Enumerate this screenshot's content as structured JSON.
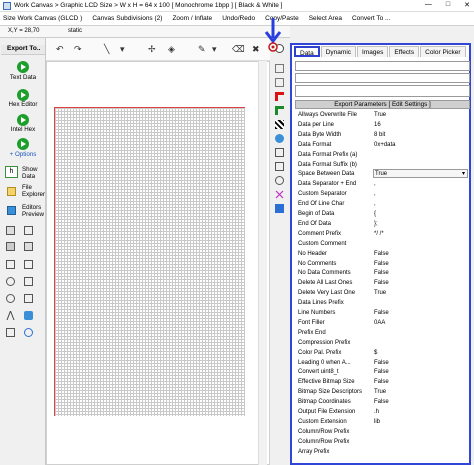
{
  "title": "Work Canvas > Graphic LCD Size > W x H = 64 x 100 [ Monochrome 1bpp ] [ Black & White ]",
  "window_controls": [
    "—",
    "□",
    "✕"
  ],
  "menu": [
    "Size Work Canvas (GLCD )",
    "Canvas Subdivisions (2)",
    "Zoom / Inflate",
    "Undo/Redo",
    "Copy/Paste",
    "Select Area",
    "Convert To ..."
  ],
  "coord": {
    "xy": "X,Y = 28,70",
    "mode": "static"
  },
  "left": {
    "header": "Export To..",
    "export_text": "Text Data",
    "hex_editor": "Hex Editor",
    "intel_hex": "Intel Hex",
    "options": "+ Options",
    "show_data": "Show Data",
    "show_data_btn": "h",
    "file_explorer": "File Explorer",
    "editors_preview": "Editors Preview"
  },
  "tabs": [
    "Data",
    "Dynamic",
    "Images",
    "Effects",
    "Color Picker"
  ],
  "props_header": "Export Parameters [ Edit Settings ]",
  "props": [
    {
      "k": "Allways Overwrite File",
      "v": "True"
    },
    {
      "k": "Data per Line",
      "v": "16"
    },
    {
      "k": "Data Byte Width",
      "v": "8 bit"
    },
    {
      "k": "Data Format",
      "v": "0x+data"
    },
    {
      "k": "Data Format Prefix (a)",
      "v": ""
    },
    {
      "k": "Data Format Suffix (b)",
      "v": ""
    },
    {
      "k": "Space Between Data",
      "v": "True"
    },
    {
      "k": "Data Separator + End",
      "v": ","
    },
    {
      "k": "Custom Separator",
      "v": ","
    },
    {
      "k": "End Of Line Char",
      "v": ","
    },
    {
      "k": "Begin of Data",
      "v": "{"
    },
    {
      "k": "End Of Data",
      "v": "};"
    },
    {
      "k": "Comment Prefix",
      "v": "*/ /*"
    },
    {
      "k": "Custom Comment",
      "v": ""
    },
    {
      "k": "No Header",
      "v": "False"
    },
    {
      "k": "No Comments",
      "v": "False"
    },
    {
      "k": "No Data Comments",
      "v": "False"
    },
    {
      "k": "Delete All Last Ones",
      "v": "False"
    },
    {
      "k": "Delete Very Last One",
      "v": "True"
    },
    {
      "k": "Data Lines Prefix",
      "v": ""
    },
    {
      "k": "Line Numbers",
      "v": "False"
    },
    {
      "k": "Font Filler",
      "v": "0AA"
    },
    {
      "k": "Prefix End",
      "v": ""
    },
    {
      "k": "Compression Prefix",
      "v": ""
    },
    {
      "k": "Color Pal. Prefix",
      "v": "$"
    },
    {
      "k": "Leading 0 when A...",
      "v": "False"
    },
    {
      "k": "Convert uint8_t",
      "v": "False"
    },
    {
      "k": "Effective Bitmap Size",
      "v": "False"
    },
    {
      "k": "Bitmap Size Descriptors",
      "v": "True"
    },
    {
      "k": "Bitmap Coordinates",
      "v": "False"
    },
    {
      "k": "Output File Extension",
      "v": ".h"
    },
    {
      "k": "Custom Extension",
      "v": "lib"
    },
    {
      "k": "Column/Row Prefix",
      "v": ""
    },
    {
      "k": "Column/Row Prefix",
      "v": ""
    },
    {
      "k": "Array Prefix",
      "v": ""
    }
  ]
}
